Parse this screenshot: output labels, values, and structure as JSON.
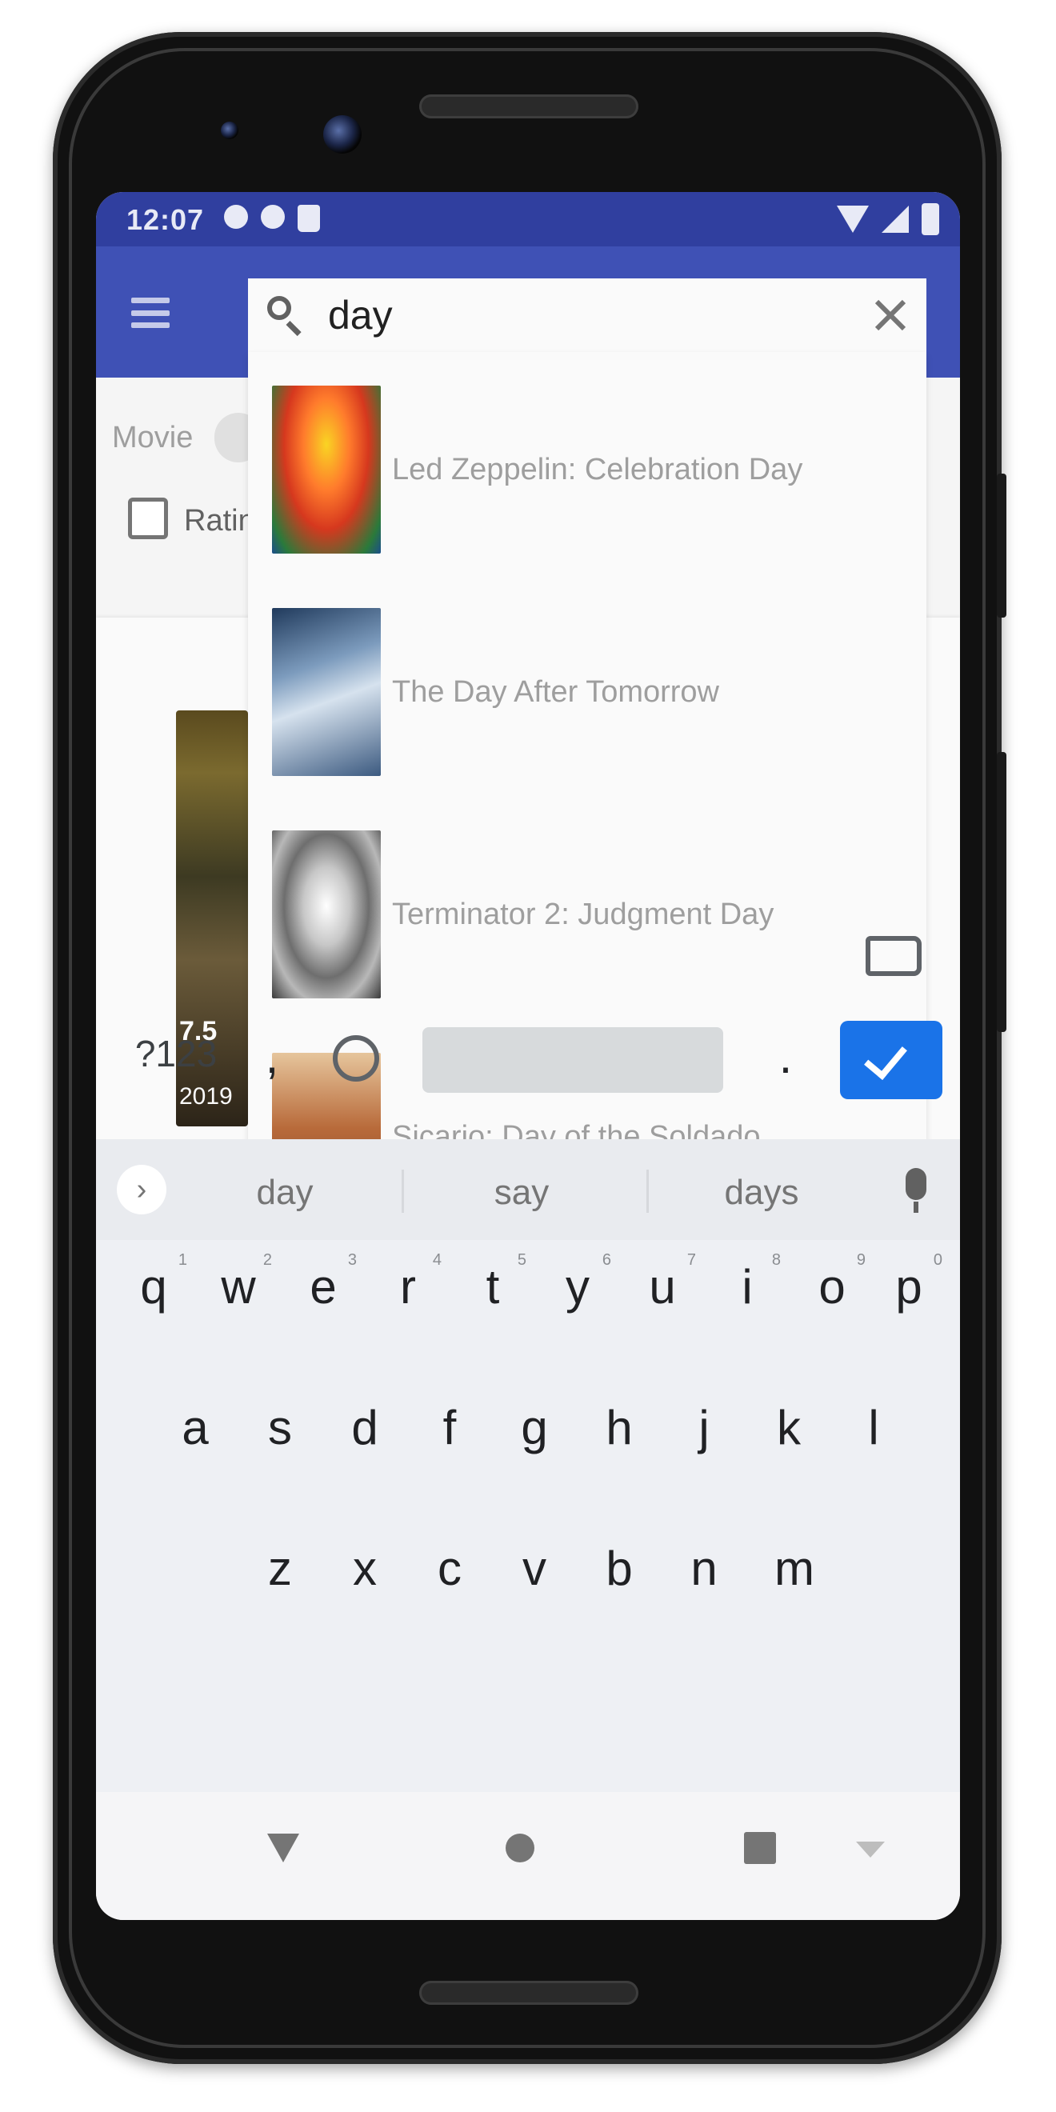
{
  "status_bar": {
    "time": "12:07"
  },
  "search": {
    "query": "day",
    "placeholder": ""
  },
  "filters": {
    "movie_label": "Movie",
    "rating_label": "Ratin"
  },
  "background_card": {
    "rating": "7.5",
    "year": "2019"
  },
  "suggestions": [
    {
      "title": "Led Zeppelin: Celebration Day"
    },
    {
      "title": "The Day After Tomorrow"
    },
    {
      "title": "Terminator 2: Judgment Day"
    },
    {
      "title": "Sicario: Day of the Soldado"
    }
  ],
  "keyboard": {
    "suggestions": [
      "day",
      "say",
      "days"
    ],
    "row1": [
      {
        "letter": "q",
        "hint": "1"
      },
      {
        "letter": "w",
        "hint": "2"
      },
      {
        "letter": "e",
        "hint": "3"
      },
      {
        "letter": "r",
        "hint": "4"
      },
      {
        "letter": "t",
        "hint": "5"
      },
      {
        "letter": "y",
        "hint": "6"
      },
      {
        "letter": "u",
        "hint": "7"
      },
      {
        "letter": "i",
        "hint": "8"
      },
      {
        "letter": "o",
        "hint": "9"
      },
      {
        "letter": "p",
        "hint": "0"
      }
    ],
    "row2": [
      "a",
      "s",
      "d",
      "f",
      "g",
      "h",
      "j",
      "k",
      "l"
    ],
    "row3": [
      "z",
      "x",
      "c",
      "v",
      "b",
      "n",
      "m"
    ],
    "symbols_label": "?123",
    "comma_label": ",",
    "period_label": "."
  },
  "colors": {
    "status_bar": "#303f9f",
    "app_bar": "#3f51b5",
    "enter_key": "#1a73e8"
  }
}
